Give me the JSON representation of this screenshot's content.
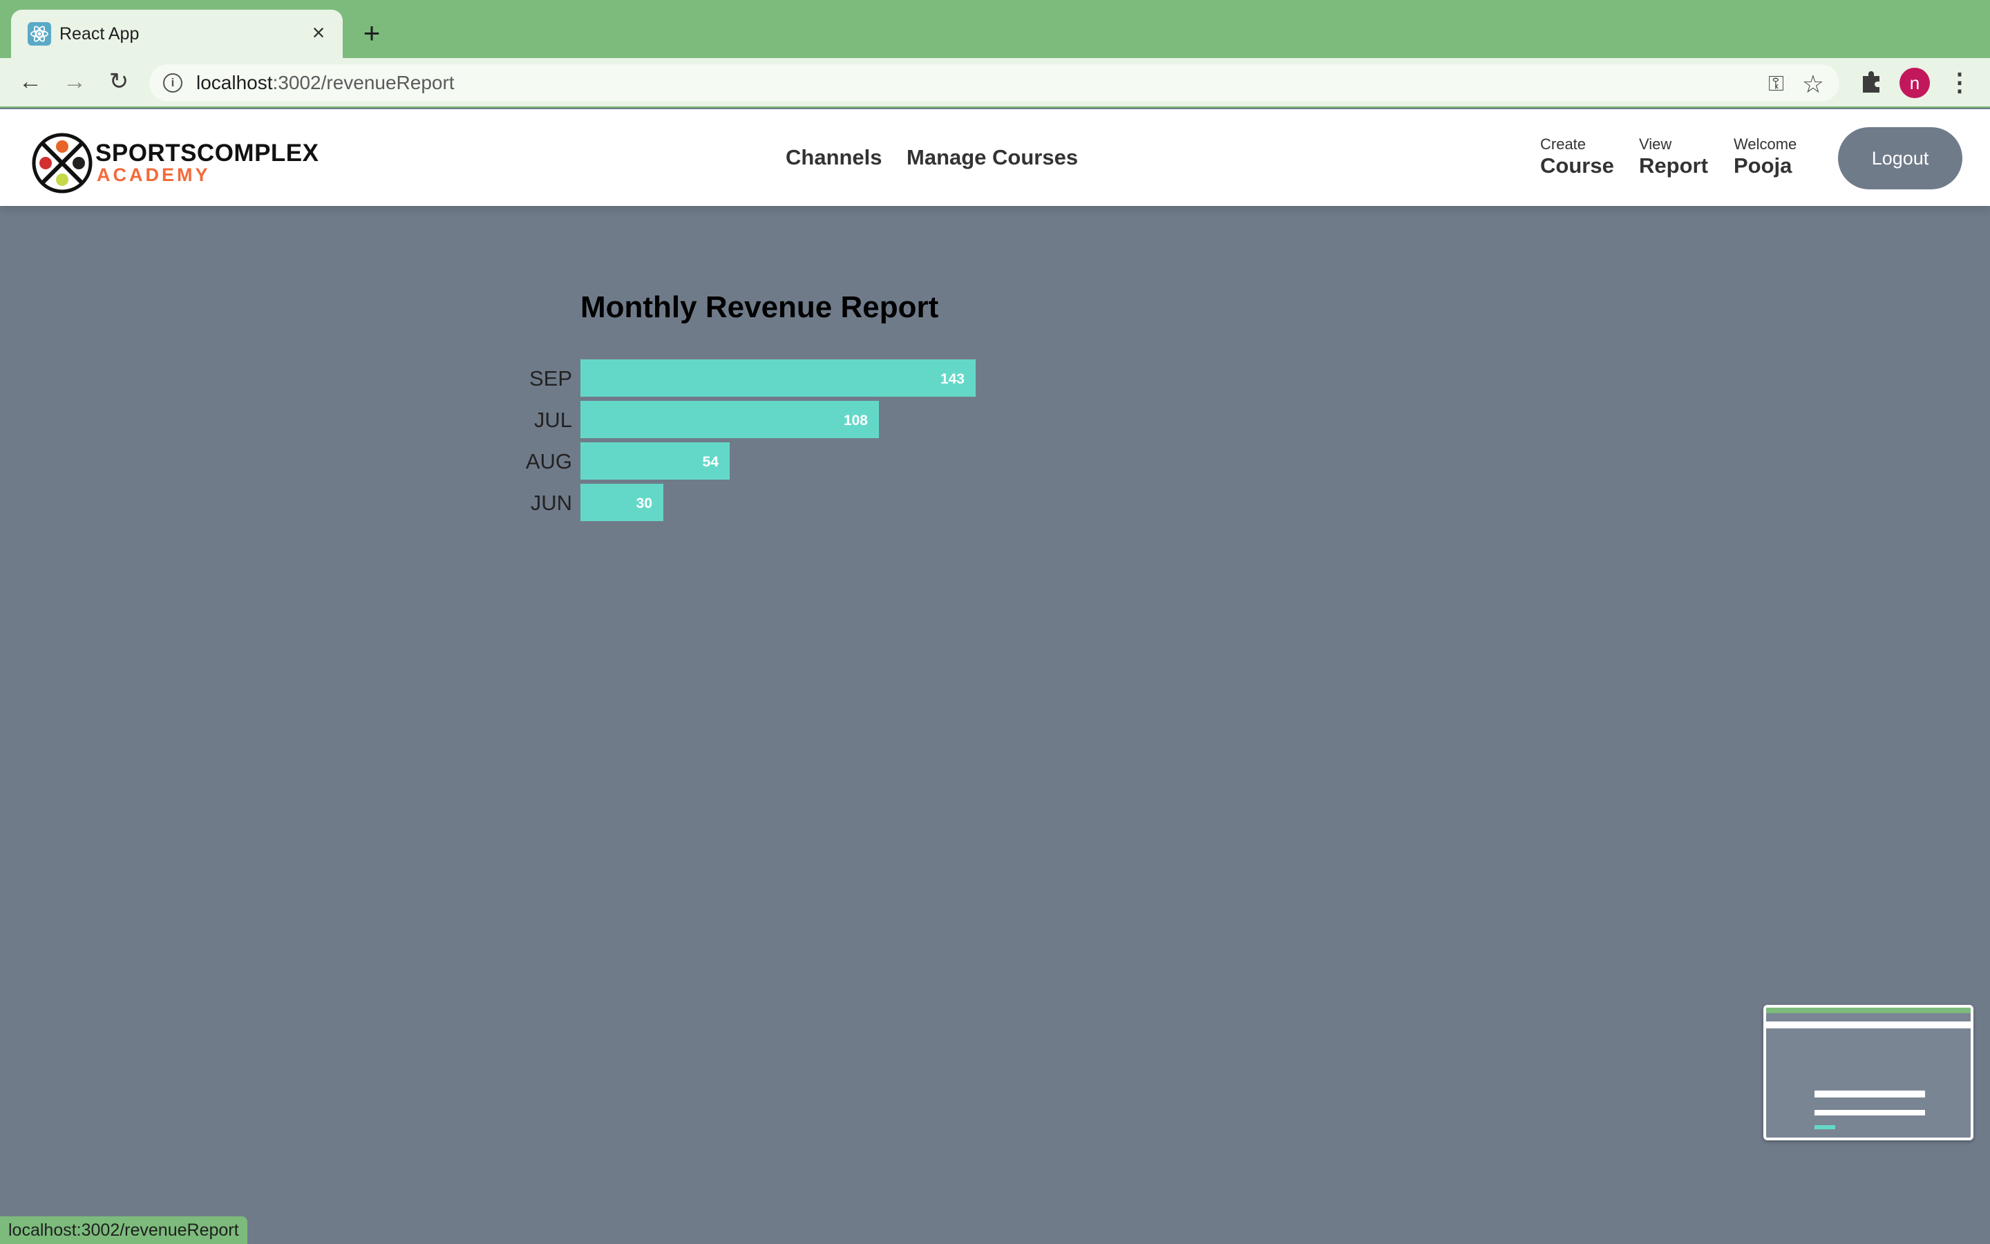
{
  "browser": {
    "tab_title": "React App",
    "url_host": "localhost",
    "url_path": ":3002/revenueReport",
    "avatar_letter": "n",
    "status_url": "localhost:3002/revenueReport"
  },
  "header": {
    "brand_top": "SPORTSCOMPLEX",
    "brand_bottom": "ACADEMY",
    "nav": {
      "channels": "Channels",
      "manage_courses": "Manage Courses"
    },
    "create": {
      "small": "Create",
      "big": "Course"
    },
    "view": {
      "small": "View",
      "big": "Report"
    },
    "welcome": {
      "small": "Welcome",
      "big": "Pooja"
    },
    "logout_label": "Logout"
  },
  "colors": {
    "bar": "#64d8c8",
    "background": "#707b8a",
    "tab_strip": "#7cbb7c",
    "brand_accent": "#f26a3a"
  },
  "chart_data": {
    "type": "bar",
    "orientation": "horizontal",
    "title": "Monthly Revenue Report",
    "categories": [
      "SEP",
      "JUL",
      "AUG",
      "JUN"
    ],
    "values": [
      143,
      108,
      54,
      30
    ],
    "grid": false
  }
}
